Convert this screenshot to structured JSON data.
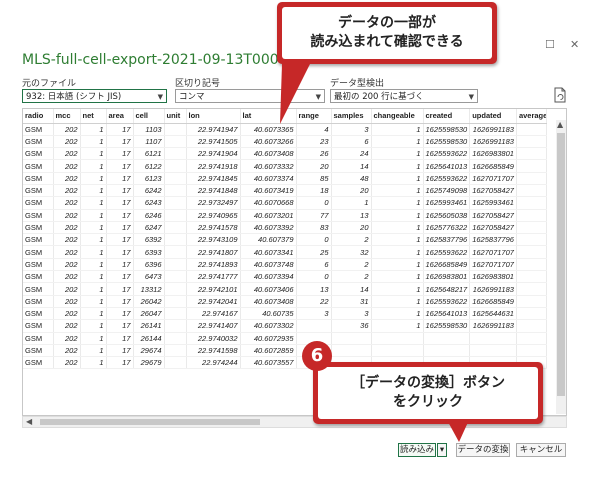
{
  "window": {
    "title": "MLS-full-cell-export-2021-09-13T000000.csv",
    "maximize_glyph": "☐",
    "close_glyph": "✕"
  },
  "options": {
    "file_origin": {
      "label": "元のファイル",
      "value": "932: 日本語 (シフト JIS)"
    },
    "delimiter": {
      "label": "区切り記号",
      "value": "コンマ"
    },
    "type_detection": {
      "label": "データ型検出",
      "value": "最初の 200 行に基づく"
    }
  },
  "table": {
    "columns": [
      "radio",
      "mcc",
      "net",
      "area",
      "cell",
      "unit",
      "lon",
      "lat",
      "range",
      "samples",
      "changeable",
      "created",
      "updated",
      "averageSi"
    ],
    "rows": [
      [
        "GSM",
        "202",
        "1",
        "17",
        "1103",
        "",
        "22.9741947",
        "40.6073365",
        "4",
        "3",
        "1",
        "1625598530",
        "1626991183",
        ""
      ],
      [
        "GSM",
        "202",
        "1",
        "17",
        "1107",
        "",
        "22.9741505",
        "40.6073266",
        "23",
        "6",
        "1",
        "1625598530",
        "1626991183",
        ""
      ],
      [
        "GSM",
        "202",
        "1",
        "17",
        "6121",
        "",
        "22.9741904",
        "40.6073408",
        "26",
        "24",
        "1",
        "1625593622",
        "1626983801",
        ""
      ],
      [
        "GSM",
        "202",
        "1",
        "17",
        "6122",
        "",
        "22.9741918",
        "40.6073332",
        "20",
        "14",
        "1",
        "1625641013",
        "1626685849",
        ""
      ],
      [
        "GSM",
        "202",
        "1",
        "17",
        "6123",
        "",
        "22.9741845",
        "40.6073374",
        "85",
        "48",
        "1",
        "1625593622",
        "1627071707",
        ""
      ],
      [
        "GSM",
        "202",
        "1",
        "17",
        "6242",
        "",
        "22.9741848",
        "40.6073419",
        "18",
        "20",
        "1",
        "1625749098",
        "1627058427",
        ""
      ],
      [
        "GSM",
        "202",
        "1",
        "17",
        "6243",
        "",
        "22.9732497",
        "40.6070668",
        "0",
        "1",
        "1",
        "1625993461",
        "1625993461",
        ""
      ],
      [
        "GSM",
        "202",
        "1",
        "17",
        "6246",
        "",
        "22.9740965",
        "40.6073201",
        "77",
        "13",
        "1",
        "1625605038",
        "1627058427",
        ""
      ],
      [
        "GSM",
        "202",
        "1",
        "17",
        "6247",
        "",
        "22.9741578",
        "40.6073392",
        "83",
        "20",
        "1",
        "1625776322",
        "1627058427",
        ""
      ],
      [
        "GSM",
        "202",
        "1",
        "17",
        "6392",
        "",
        "22.9743109",
        "40.607379",
        "0",
        "2",
        "1",
        "1625837796",
        "1625837796",
        ""
      ],
      [
        "GSM",
        "202",
        "1",
        "17",
        "6393",
        "",
        "22.9741807",
        "40.6073341",
        "25",
        "32",
        "1",
        "1625593622",
        "1627071707",
        ""
      ],
      [
        "GSM",
        "202",
        "1",
        "17",
        "6396",
        "",
        "22.9741893",
        "40.6073748",
        "6",
        "2",
        "1",
        "1626685849",
        "1627071707",
        ""
      ],
      [
        "GSM",
        "202",
        "1",
        "17",
        "6473",
        "",
        "22.9741777",
        "40.6073394",
        "0",
        "2",
        "1",
        "1626983801",
        "1626983801",
        ""
      ],
      [
        "GSM",
        "202",
        "1",
        "17",
        "13312",
        "",
        "22.9742101",
        "40.6073406",
        "13",
        "14",
        "1",
        "1625648217",
        "1626991183",
        ""
      ],
      [
        "GSM",
        "202",
        "1",
        "17",
        "26042",
        "",
        "22.9742041",
        "40.6073408",
        "22",
        "31",
        "1",
        "1625593622",
        "1626685849",
        ""
      ],
      [
        "GSM",
        "202",
        "1",
        "17",
        "26047",
        "",
        "22.974167",
        "40.60735",
        "3",
        "3",
        "1",
        "1625641013",
        "1625644631",
        ""
      ],
      [
        "GSM",
        "202",
        "1",
        "17",
        "26141",
        "",
        "22.9741407",
        "40.6073302",
        "",
        "36",
        "1",
        "1625598530",
        "1626991183",
        ""
      ],
      [
        "GSM",
        "202",
        "1",
        "17",
        "26144",
        "",
        "22.9740032",
        "40.6072935",
        "",
        "",
        "",
        "",
        "",
        ""
      ],
      [
        "GSM",
        "202",
        "1",
        "17",
        "29674",
        "",
        "22.9741598",
        "40.6072859",
        "",
        "",
        "",
        "",
        "",
        ""
      ],
      [
        "GSM",
        "202",
        "1",
        "17",
        "29679",
        "",
        "22.974244",
        "40.6073557",
        "",
        "",
        "",
        "",
        "",
        ""
      ]
    ]
  },
  "buttons": {
    "load": "読み込み",
    "load_dropdown": "▾",
    "transform": "データの変換",
    "cancel": "キャンセル"
  },
  "callouts": {
    "top": "データの一部が\n読み込まれて確認できる",
    "bottom": "［データの変換］ボタン\nをクリック",
    "step_number": "6"
  },
  "colors": {
    "accent": "#217346",
    "callout_red": "#c62828",
    "title_green": "#2e7d32"
  },
  "icons": {
    "file_refresh": "file-refresh-icon",
    "scroll_up": "▲",
    "scroll_left": "◀"
  }
}
